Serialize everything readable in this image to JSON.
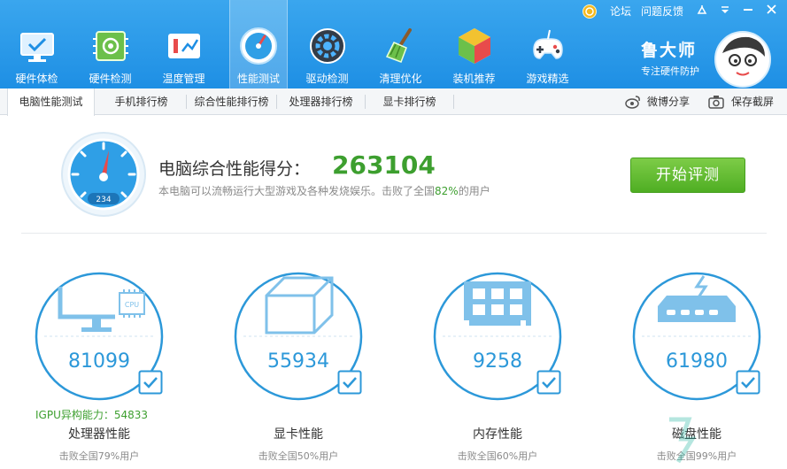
{
  "nav": {
    "items": [
      {
        "label": "硬件体检",
        "icon": "monitor-check-icon"
      },
      {
        "label": "硬件检测",
        "icon": "circuit-board-icon"
      },
      {
        "label": "温度管理",
        "icon": "thermometer-icon"
      },
      {
        "label": "性能测试",
        "icon": "speedometer-icon"
      },
      {
        "label": "驱动检测",
        "icon": "gear-driver-icon"
      },
      {
        "label": "清理优化",
        "icon": "broom-icon"
      },
      {
        "label": "装机推荐",
        "icon": "cube-icon"
      },
      {
        "label": "游戏精选",
        "icon": "gamepad-icon"
      }
    ],
    "active_index": 3
  },
  "topright": {
    "forum": "论坛",
    "feedback": "问题反馈"
  },
  "brand": {
    "name": "鲁大师",
    "slogan": "专注硬件防护"
  },
  "tabs": [
    "电脑性能测试",
    "手机排行榜",
    "综合性能排行榜",
    "处理器排行榜",
    "显卡排行榜"
  ],
  "share": {
    "weibo": "微博分享",
    "screenshot": "保存截屏"
  },
  "score": {
    "title": "电脑综合性能得分：",
    "value": "263104",
    "desc_prefix": "本电脑可以流畅运行大型游戏及各种发烧娱乐。击败了全国",
    "desc_pct": "82%",
    "desc_suffix": "的用户",
    "gauge_readout": "234"
  },
  "start_button": "开始评测",
  "cards": [
    {
      "name": "处理器性能",
      "score": "81099",
      "beat": "击败全国79%用户",
      "extra": "IGPU异构能力：54833",
      "chip_label": "CPU"
    },
    {
      "name": "显卡性能",
      "score": "55934",
      "beat": "击败全国50%用户"
    },
    {
      "name": "内存性能",
      "score": "9258",
      "beat": "击败全国60%用户"
    },
    {
      "name": "磁盘性能",
      "score": "61980",
      "beat": "击败全国99%用户"
    }
  ],
  "colors": {
    "header_blue": "#1e8fe4",
    "score_green": "#3d9f2f",
    "ring_blue": "#2c98d9",
    "button_green": "#4fae23"
  }
}
